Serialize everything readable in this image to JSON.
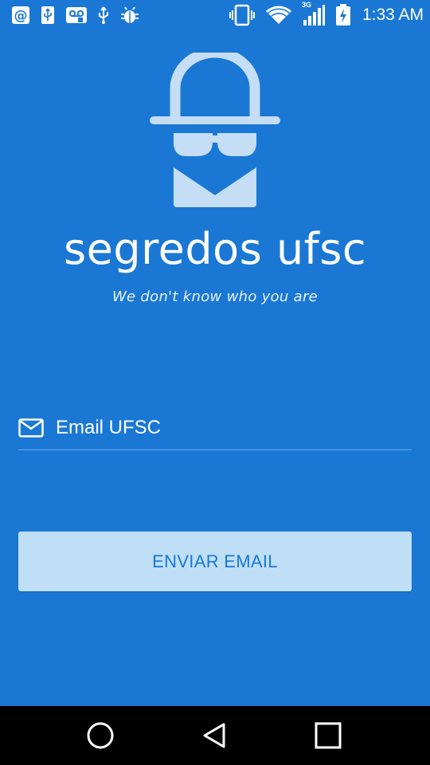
{
  "status_bar": {
    "time": "1:33 AM",
    "network_label": "3G",
    "left_icons": [
      "at-sign-icon",
      "usb-icon",
      "voicemail-icon",
      "usb-icon",
      "debug-bug-icon"
    ],
    "right_icons": [
      "vibrate-icon",
      "wifi-icon",
      "signal-icon",
      "battery-charging-icon"
    ]
  },
  "app": {
    "title": "segredos ufsc",
    "tagline": "We don't know who you are"
  },
  "form": {
    "email_placeholder": "Email UFSC",
    "email_value": "",
    "submit_label": "ENVIAR EMAIL"
  },
  "colors": {
    "background": "#1a78d4",
    "logo": "#c5ddf5",
    "button_background": "#bfdff7",
    "button_text": "#1a78d4",
    "nav_bar": "#000000"
  },
  "nav_bar": {
    "buttons": [
      "back-icon",
      "home-icon",
      "recents-icon"
    ]
  }
}
